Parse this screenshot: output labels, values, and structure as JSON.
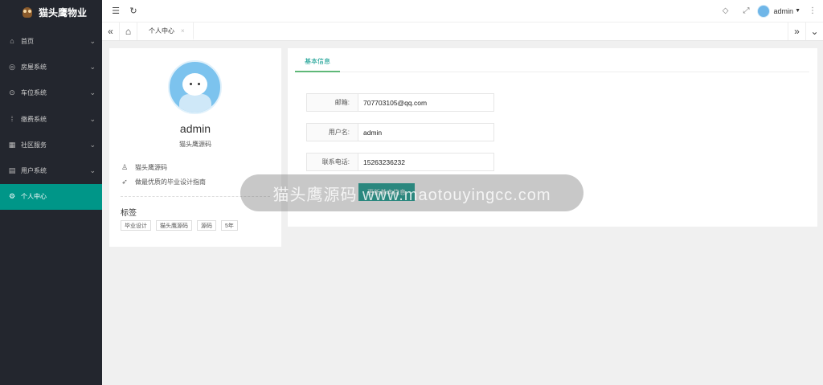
{
  "app": {
    "title": "猫头鹰物业"
  },
  "sidebar": {
    "items": [
      {
        "icon": "home-icon",
        "glyph": "⌂",
        "label": "首页",
        "arrow": "⌄"
      },
      {
        "icon": "house-system-icon",
        "glyph": "◎",
        "label": "房屋系统",
        "arrow": "⌄"
      },
      {
        "icon": "parking-system-icon",
        "glyph": "⊙",
        "label": "车位系统",
        "arrow": "⌄"
      },
      {
        "icon": "payment-system-icon",
        "glyph": "⁞",
        "label": "缴费系统",
        "arrow": "⌄"
      },
      {
        "icon": "community-service-icon",
        "glyph": "▦",
        "label": "社区服务",
        "arrow": "⌄"
      },
      {
        "icon": "user-system-icon",
        "glyph": "▤",
        "label": "用户系统",
        "arrow": "⌄"
      },
      {
        "icon": "personal-center-icon",
        "glyph": "⚙",
        "label": "个人中心",
        "arrow": ""
      }
    ],
    "active_index": 6
  },
  "header": {
    "menu_toggle_glyph": "☰",
    "refresh_glyph": "↻",
    "tag_glyph": "◇",
    "fullscreen_glyph": "⤢",
    "more_glyph": "⋮",
    "user": "admin",
    "caret": "▼"
  },
  "tabs": {
    "left_glyph": "«",
    "home_glyph": "⌂",
    "items": [
      {
        "label": "个人中心",
        "close": "×"
      }
    ],
    "right_glyph": "»",
    "dropdown_glyph": "⌄"
  },
  "profile": {
    "username": "admin",
    "subtitle": "猫头鹰源码",
    "info_user_glyph": "♙",
    "info_user": "猫头鹰源码",
    "info_slogan_glyph": "➶",
    "info_slogan": "做最优质的毕业设计指南",
    "tags_title": "标签",
    "tags": [
      "毕业设计",
      "猫头鹰源码",
      "源码",
      "5年"
    ]
  },
  "form": {
    "tab_label": "基本信息",
    "email_label": "邮箱:",
    "email_value": "707703105@qq.com",
    "username_label": "用户名:",
    "username_value": "admin",
    "phone_label": "联系电话:",
    "phone_value": "15263236232",
    "submit_label": "更新基本信息"
  },
  "watermark": {
    "text": "猫头鹰源码 www.maotouyingcc.com"
  },
  "colors": {
    "accent": "#009688",
    "sidebar_bg": "#23262e"
  }
}
